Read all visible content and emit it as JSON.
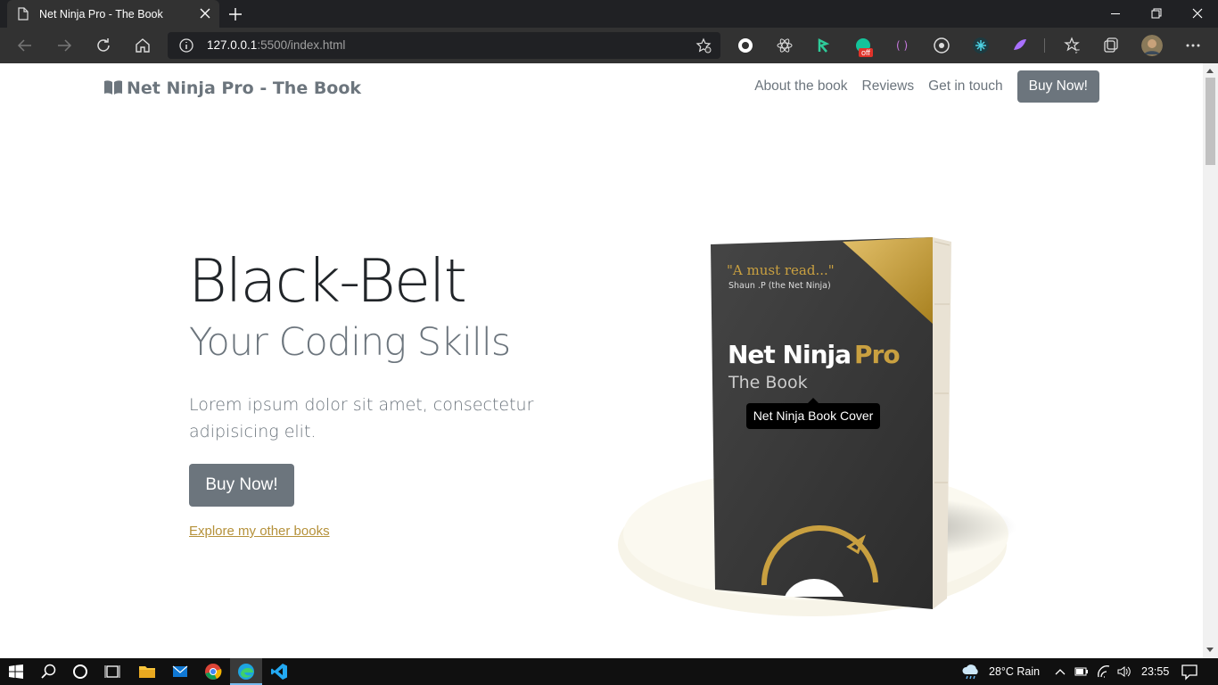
{
  "browser": {
    "tab_title": "Net Ninja Pro - The Book",
    "url_host": "127.0.0.1",
    "url_rest": ":5500/index.html",
    "extension_badge": "off"
  },
  "navbar": {
    "brand": "Net Ninja Pro - The Book",
    "links": [
      "About the book",
      "Reviews",
      "Get in touch"
    ],
    "buy_label": "Buy Now!"
  },
  "hero": {
    "title": "Black-Belt",
    "subtitle": "Your Coding Skills",
    "lead": "Lorem ipsum dolor sit amet, consectetur adipisicing elit.",
    "buy_label": "Buy Now!",
    "link_label": "Explore my other books"
  },
  "book": {
    "quote": "\"A must read...\"",
    "quote_author": "Shaun .P (the Net Ninja)",
    "title_main": "Net Ninja",
    "title_pro": "Pro",
    "title_sub": "The Book",
    "tooltip": "Net Ninja Book Cover"
  },
  "taskbar": {
    "weather": "28°C  Rain",
    "time": "23:55"
  },
  "colors": {
    "accent_gold": "#b5913a",
    "button_gray": "#6c757d",
    "book_dark": "#3b3b3b"
  }
}
